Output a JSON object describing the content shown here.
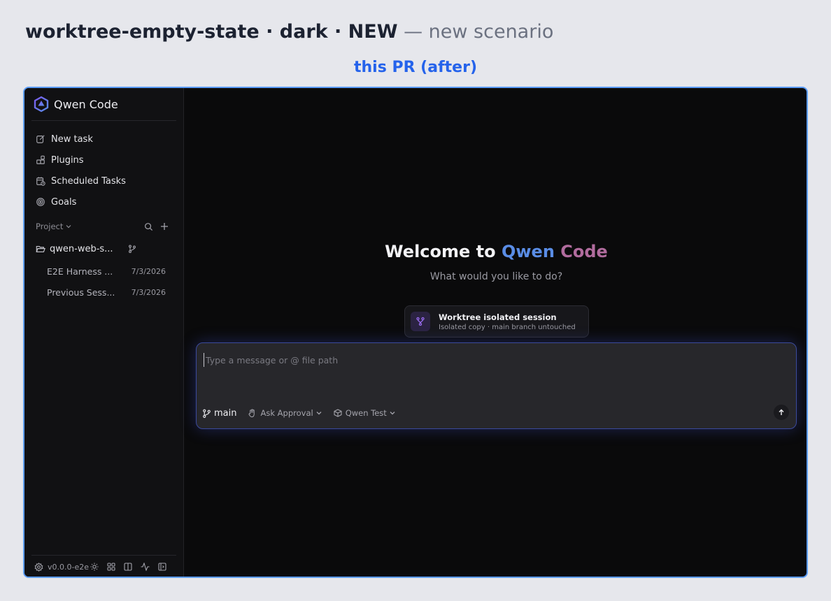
{
  "header": {
    "title_strong": "worktree-empty-state · dark · NEW",
    "title_muted": "— new scenario",
    "subtitle": "this PR (after)"
  },
  "sidebar": {
    "brand": "Qwen Code",
    "nav": [
      {
        "label": "New task",
        "icon": "edit-icon"
      },
      {
        "label": "Plugins",
        "icon": "plugins-icon"
      },
      {
        "label": "Scheduled Tasks",
        "icon": "calendar-clock-icon"
      },
      {
        "label": "Goals",
        "icon": "target-icon"
      }
    ],
    "project_label": "Project",
    "project_name": "qwen-web-s...",
    "sessions": [
      {
        "title": "E2E Harness ...",
        "date": "7/3/2026"
      },
      {
        "title": "Previous Sess...",
        "date": "7/3/2026"
      }
    ],
    "version": "v0.0.0-e2e"
  },
  "main": {
    "welcome_prefix": "Welcome to ",
    "welcome_q": "Qwen",
    "welcome_c": " Code",
    "prompt": "What would you like to do?",
    "chip_title": "Worktree isolated session",
    "chip_sub": "Isolated copy · main branch untouched",
    "composer": {
      "placeholder": "Type a message or @ file path",
      "value": "",
      "branch": "main",
      "approval": "Ask Approval",
      "model": "Qwen Test"
    }
  },
  "colors": {
    "accent_blue": "#2563eb",
    "qwen_blue": "#5a8de6",
    "code_pink": "#b16c9e",
    "frame_border": "#5b9cf7",
    "composer_glow": "#3b4a9c"
  }
}
